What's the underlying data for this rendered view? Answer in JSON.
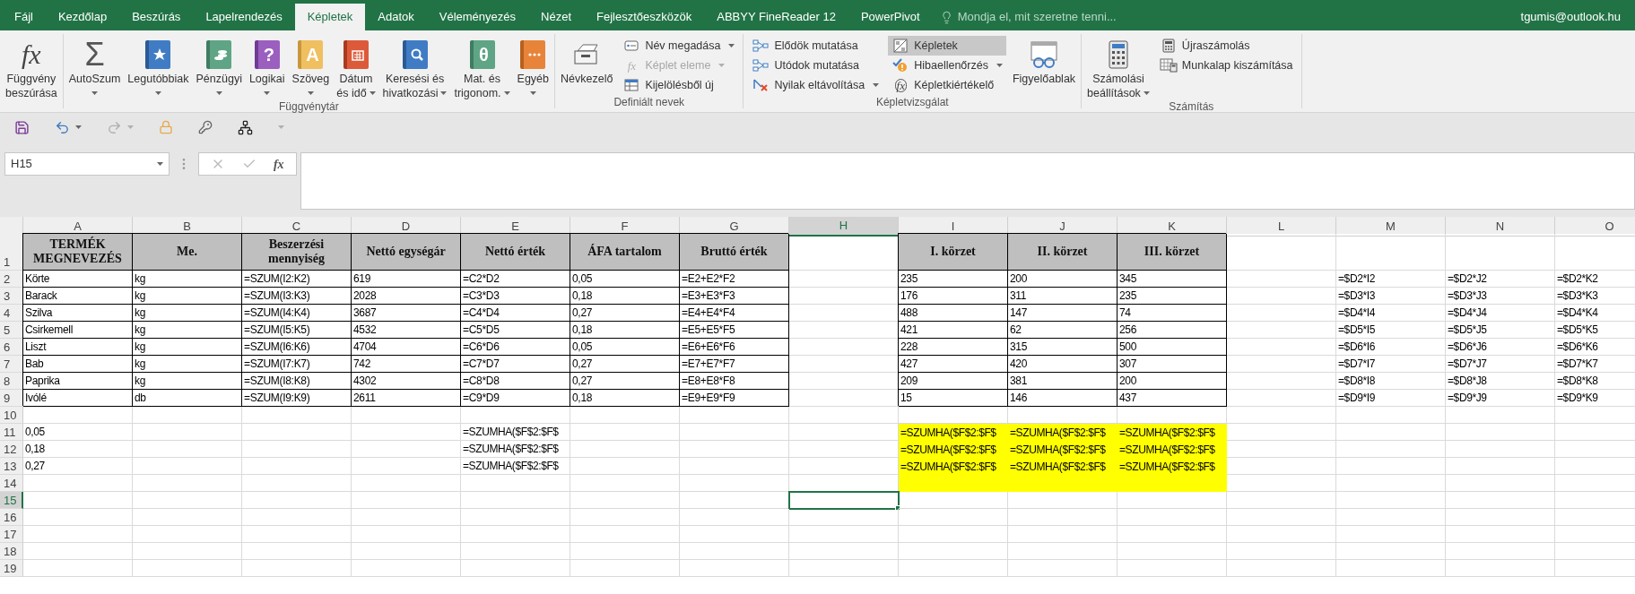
{
  "tabs": [
    {
      "label": "Fájl",
      "selected": false
    },
    {
      "label": "Kezdőlap",
      "selected": false
    },
    {
      "label": "Beszúrás",
      "selected": false
    },
    {
      "label": "Lapelrendezés",
      "selected": false
    },
    {
      "label": "Képletek",
      "selected": true
    },
    {
      "label": "Adatok",
      "selected": false
    },
    {
      "label": "Véleményezés",
      "selected": false
    },
    {
      "label": "Nézet",
      "selected": false
    },
    {
      "label": "Fejlesztőeszközök",
      "selected": false
    },
    {
      "label": "ABBYY FineReader 12",
      "selected": false
    },
    {
      "label": "PowerPivot",
      "selected": false
    }
  ],
  "tell_me": "Mondja el, mit szeretne tenni...",
  "account": "tgumis@outlook.hu",
  "ribbon": [
    {
      "items": [
        {
          "kind": "large",
          "lines": [
            "Függvény",
            "beszúrása"
          ],
          "dropdown": false,
          "icon_text": "fx"
        }
      ]
    },
    {
      "label": "Függvénytár",
      "items": [
        {
          "kind": "large",
          "lines": [
            "AutoSzum"
          ],
          "dropdown": true,
          "icon_text": "Σ"
        },
        {
          "kind": "large",
          "lines": [
            "Legutóbbiak"
          ],
          "dropdown": true
        },
        {
          "kind": "large",
          "lines": [
            "Pénzügyi"
          ],
          "dropdown": true
        },
        {
          "kind": "large",
          "lines": [
            "Logikai"
          ],
          "dropdown": true,
          "icon_text": "?"
        },
        {
          "kind": "large",
          "lines": [
            "Szöveg"
          ],
          "dropdown": true,
          "icon_text": "A"
        },
        {
          "kind": "large",
          "lines": [
            "Dátum",
            "és idő"
          ],
          "dropdown": true
        },
        {
          "kind": "large",
          "lines": [
            "Keresési és",
            "hivatkozási"
          ],
          "dropdown": true
        },
        {
          "kind": "large",
          "lines": [
            "Mat. és",
            "trigonom."
          ],
          "dropdown": true,
          "icon_text": "θ"
        },
        {
          "kind": "large",
          "lines": [
            "Egyéb"
          ],
          "dropdown": true
        }
      ]
    },
    {
      "label": "Definiált nevek",
      "items": [
        {
          "kind": "large",
          "lines": [
            "Névkezelő"
          ],
          "dropdown": false
        },
        {
          "kind": "stack",
          "items": [
            {
              "label": "Név megadása",
              "dropdown": true,
              "on": false,
              "disabled": false
            },
            {
              "label": "Képlet eleme",
              "dropdown": true,
              "on": false,
              "disabled": true,
              "icon_text": "fx"
            },
            {
              "label": "Kijelölésből új",
              "dropdown": false,
              "on": false,
              "disabled": false
            }
          ]
        }
      ]
    },
    {
      "label": "Képletvizsgálat",
      "items": [
        {
          "kind": "stack",
          "items": [
            {
              "label": "Elődök mutatása",
              "dropdown": false,
              "on": false,
              "disabled": false
            },
            {
              "label": "Utódok mutatása",
              "dropdown": false,
              "on": false,
              "disabled": false
            },
            {
              "label": "Nyilak eltávolítása",
              "dropdown": true,
              "on": false,
              "disabled": false
            }
          ]
        },
        {
          "kind": "stack",
          "items": [
            {
              "label": "Képletek",
              "dropdown": false,
              "on": true,
              "disabled": false
            },
            {
              "label": "Hibaellenőrzés",
              "dropdown": true,
              "on": false,
              "disabled": false
            },
            {
              "label": "Képletkiértékelő",
              "dropdown": false,
              "on": false,
              "disabled": false,
              "icon_text": "fx"
            }
          ]
        },
        {
          "kind": "large",
          "lines": [
            "Figyelőablak"
          ],
          "dropdown": false
        }
      ]
    },
    {
      "label": "Számítás",
      "items": [
        {
          "kind": "large",
          "lines": [
            "Számolási",
            "beállítások"
          ],
          "dropdown": true
        },
        {
          "kind": "stack",
          "items": [
            {
              "label": "Újraszámolás",
              "dropdown": false,
              "on": false,
              "disabled": false
            },
            {
              "label": "Munkalap kiszámítása",
              "dropdown": false,
              "on": false,
              "disabled": false
            }
          ]
        }
      ]
    }
  ],
  "formula_bar": {
    "name_box": "H15",
    "function_glyph": "fx"
  },
  "sheet": {
    "columns": [
      {
        "label": "A",
        "selected": false
      },
      {
        "label": "B",
        "selected": false
      },
      {
        "label": "C",
        "selected": false
      },
      {
        "label": "D",
        "selected": false
      },
      {
        "label": "E",
        "selected": false
      },
      {
        "label": "F",
        "selected": false
      },
      {
        "label": "G",
        "selected": false
      },
      {
        "label": "H",
        "selected": true
      },
      {
        "label": "I",
        "selected": false
      },
      {
        "label": "J",
        "selected": false
      },
      {
        "label": "K",
        "selected": false
      },
      {
        "label": "L",
        "selected": false
      },
      {
        "label": "M",
        "selected": false
      },
      {
        "label": "N",
        "selected": false
      },
      {
        "label": "O",
        "selected": false
      }
    ],
    "rows": [
      {
        "number": "1",
        "selected": false,
        "cells": [
          {
            "text": "TERMÉK MEGNEVEZÉS",
            "kind": "header"
          },
          {
            "text": "Me.",
            "kind": "header"
          },
          {
            "text": "Beszerzési mennyiség",
            "kind": "header"
          },
          {
            "text": "Nettó egységár",
            "kind": "header"
          },
          {
            "text": "Nettó érték",
            "kind": "header"
          },
          {
            "text": "ÁFA tartalom",
            "kind": "header"
          },
          {
            "text": "Bruttó érték",
            "kind": "header"
          },
          null,
          {
            "text": "I. körzet",
            "kind": "header"
          },
          {
            "text": "II. körzet",
            "kind": "header"
          },
          {
            "text": "III. körzet",
            "kind": "header"
          }
        ]
      },
      {
        "number": "2",
        "selected": false,
        "cells": [
          {
            "text": "Körte",
            "kind": "bordered"
          },
          {
            "text": "kg",
            "kind": "bordered"
          },
          {
            "text": "=SZUM(I2:K2)",
            "kind": "bordered"
          },
          {
            "text": "619",
            "kind": "bordered"
          },
          {
            "text": "=C2*D2",
            "kind": "bordered"
          },
          {
            "text": "0,05",
            "kind": "bordered"
          },
          {
            "text": "=E2+E2*F2",
            "kind": "bordered"
          },
          null,
          {
            "text": "235",
            "kind": "bordered"
          },
          {
            "text": "200",
            "kind": "bordered"
          },
          {
            "text": "345",
            "kind": "bordered"
          },
          null,
          {
            "text": "=$D2*I2",
            "kind": "plain"
          },
          {
            "text": "=$D2*J2",
            "kind": "plain"
          },
          {
            "text": "=$D2*K2",
            "kind": "plain"
          }
        ]
      },
      {
        "number": "3",
        "selected": false,
        "cells": [
          {
            "text": "Barack",
            "kind": "bordered"
          },
          {
            "text": "kg",
            "kind": "bordered"
          },
          {
            "text": "=SZUM(I3:K3)",
            "kind": "bordered"
          },
          {
            "text": "2028",
            "kind": "bordered"
          },
          {
            "text": "=C3*D3",
            "kind": "bordered"
          },
          {
            "text": "0,18",
            "kind": "bordered"
          },
          {
            "text": "=E3+E3*F3",
            "kind": "bordered"
          },
          null,
          {
            "text": "176",
            "kind": "bordered"
          },
          {
            "text": "311",
            "kind": "bordered"
          },
          {
            "text": "235",
            "kind": "bordered"
          },
          null,
          {
            "text": "=$D3*I3",
            "kind": "plain"
          },
          {
            "text": "=$D3*J3",
            "kind": "plain"
          },
          {
            "text": "=$D3*K3",
            "kind": "plain"
          }
        ]
      },
      {
        "number": "4",
        "selected": false,
        "cells": [
          {
            "text": "Szilva",
            "kind": "bordered"
          },
          {
            "text": "kg",
            "kind": "bordered"
          },
          {
            "text": "=SZUM(I4:K4)",
            "kind": "bordered"
          },
          {
            "text": "3687",
            "kind": "bordered"
          },
          {
            "text": "=C4*D4",
            "kind": "bordered"
          },
          {
            "text": "0,27",
            "kind": "bordered"
          },
          {
            "text": "=E4+E4*F4",
            "kind": "bordered"
          },
          null,
          {
            "text": "488",
            "kind": "bordered"
          },
          {
            "text": "147",
            "kind": "bordered"
          },
          {
            "text": "74",
            "kind": "bordered"
          },
          null,
          {
            "text": "=$D4*I4",
            "kind": "plain"
          },
          {
            "text": "=$D4*J4",
            "kind": "plain"
          },
          {
            "text": "=$D4*K4",
            "kind": "plain"
          }
        ]
      },
      {
        "number": "5",
        "selected": false,
        "cells": [
          {
            "text": "Csirkemell",
            "kind": "bordered"
          },
          {
            "text": "kg",
            "kind": "bordered"
          },
          {
            "text": "=SZUM(I5:K5)",
            "kind": "bordered"
          },
          {
            "text": "4532",
            "kind": "bordered"
          },
          {
            "text": "=C5*D5",
            "kind": "bordered"
          },
          {
            "text": "0,18",
            "kind": "bordered"
          },
          {
            "text": "=E5+E5*F5",
            "kind": "bordered"
          },
          null,
          {
            "text": "421",
            "kind": "bordered"
          },
          {
            "text": "62",
            "kind": "bordered"
          },
          {
            "text": "256",
            "kind": "bordered"
          },
          null,
          {
            "text": "=$D5*I5",
            "kind": "plain"
          },
          {
            "text": "=$D5*J5",
            "kind": "plain"
          },
          {
            "text": "=$D5*K5",
            "kind": "plain"
          }
        ]
      },
      {
        "number": "6",
        "selected": false,
        "cells": [
          {
            "text": "Liszt",
            "kind": "bordered"
          },
          {
            "text": "kg",
            "kind": "bordered"
          },
          {
            "text": "=SZUM(I6:K6)",
            "kind": "bordered"
          },
          {
            "text": "4704",
            "kind": "bordered"
          },
          {
            "text": "=C6*D6",
            "kind": "bordered"
          },
          {
            "text": "0,05",
            "kind": "bordered"
          },
          {
            "text": "=E6+E6*F6",
            "kind": "bordered"
          },
          null,
          {
            "text": "228",
            "kind": "bordered"
          },
          {
            "text": "315",
            "kind": "bordered"
          },
          {
            "text": "500",
            "kind": "bordered"
          },
          null,
          {
            "text": "=$D6*I6",
            "kind": "plain"
          },
          {
            "text": "=$D6*J6",
            "kind": "plain"
          },
          {
            "text": "=$D6*K6",
            "kind": "plain"
          }
        ]
      },
      {
        "number": "7",
        "selected": false,
        "cells": [
          {
            "text": "Bab",
            "kind": "bordered"
          },
          {
            "text": "kg",
            "kind": "bordered"
          },
          {
            "text": "=SZUM(I7:K7)",
            "kind": "bordered"
          },
          {
            "text": "742",
            "kind": "bordered"
          },
          {
            "text": "=C7*D7",
            "kind": "bordered"
          },
          {
            "text": "0,27",
            "kind": "bordered"
          },
          {
            "text": "=E7+E7*F7",
            "kind": "bordered"
          },
          null,
          {
            "text": "427",
            "kind": "bordered"
          },
          {
            "text": "420",
            "kind": "bordered"
          },
          {
            "text": "307",
            "kind": "bordered"
          },
          null,
          {
            "text": "=$D7*I7",
            "kind": "plain"
          },
          {
            "text": "=$D7*J7",
            "kind": "plain"
          },
          {
            "text": "=$D7*K7",
            "kind": "plain"
          }
        ]
      },
      {
        "number": "8",
        "selected": false,
        "cells": [
          {
            "text": "Paprika",
            "kind": "bordered"
          },
          {
            "text": "kg",
            "kind": "bordered"
          },
          {
            "text": "=SZUM(I8:K8)",
            "kind": "bordered"
          },
          {
            "text": "4302",
            "kind": "bordered"
          },
          {
            "text": "=C8*D8",
            "kind": "bordered"
          },
          {
            "text": "0,27",
            "kind": "bordered"
          },
          {
            "text": "=E8+E8*F8",
            "kind": "bordered"
          },
          null,
          {
            "text": "209",
            "kind": "bordered"
          },
          {
            "text": "381",
            "kind": "bordered"
          },
          {
            "text": "200",
            "kind": "bordered"
          },
          null,
          {
            "text": "=$D8*I8",
            "kind": "plain"
          },
          {
            "text": "=$D8*J8",
            "kind": "plain"
          },
          {
            "text": "=$D8*K8",
            "kind": "plain"
          }
        ]
      },
      {
        "number": "9",
        "selected": false,
        "cells": [
          {
            "text": "Ivólé",
            "kind": "bordered"
          },
          {
            "text": "db",
            "kind": "bordered"
          },
          {
            "text": "=SZUM(I9:K9)",
            "kind": "bordered"
          },
          {
            "text": "2611",
            "kind": "bordered"
          },
          {
            "text": "=C9*D9",
            "kind": "bordered"
          },
          {
            "text": "0,18",
            "kind": "bordered"
          },
          {
            "text": "=E9+E9*F9",
            "kind": "bordered"
          },
          null,
          {
            "text": "15",
            "kind": "bordered"
          },
          {
            "text": "146",
            "kind": "bordered"
          },
          {
            "text": "437",
            "kind": "bordered"
          },
          null,
          {
            "text": "=$D9*I9",
            "kind": "plain"
          },
          {
            "text": "=$D9*J9",
            "kind": "plain"
          },
          {
            "text": "=$D9*K9",
            "kind": "plain"
          }
        ]
      },
      {
        "number": "10",
        "selected": false
      },
      {
        "number": "11",
        "selected": false,
        "cells": [
          {
            "text": "0,05",
            "kind": "plain"
          },
          null,
          null,
          null,
          {
            "text": "=SZUMHA($F$2:$F$",
            "kind": "plain"
          },
          null,
          null,
          null,
          {
            "text": "=SZUMHA($F$2:$F$",
            "kind": "highlight"
          },
          {
            "text": "=SZUMHA($F$2:$F$",
            "kind": "highlight"
          },
          {
            "text": "=SZUMHA($F$2:$F$",
            "kind": "highlight"
          }
        ]
      },
      {
        "number": "12",
        "selected": false,
        "cells": [
          {
            "text": "0,18",
            "kind": "plain"
          },
          null,
          null,
          null,
          {
            "text": "=SZUMHA($F$2:$F$",
            "kind": "plain"
          },
          null,
          null,
          null,
          {
            "text": "=SZUMHA($F$2:$F$",
            "kind": "highlight"
          },
          {
            "text": "=SZUMHA($F$2:$F$",
            "kind": "highlight"
          },
          {
            "text": "=SZUMHA($F$2:$F$",
            "kind": "highlight"
          }
        ]
      },
      {
        "number": "13",
        "selected": false,
        "cells": [
          {
            "text": "0,27",
            "kind": "plain"
          },
          null,
          null,
          null,
          {
            "text": "=SZUMHA($F$2:$F$",
            "kind": "plain"
          },
          null,
          null,
          null,
          {
            "text": "=SZUMHA($F$2:$F$",
            "kind": "highlight"
          },
          {
            "text": "=SZUMHA($F$2:$F$",
            "kind": "highlight"
          },
          {
            "text": "=SZUMHA($F$2:$F$",
            "kind": "highlight"
          }
        ]
      },
      {
        "number": "14",
        "selected": false,
        "cells": [
          null,
          null,
          null,
          null,
          null,
          null,
          null,
          null,
          {
            "kind": "highlight"
          },
          {
            "kind": "highlight"
          },
          {
            "kind": "highlight"
          }
        ]
      },
      {
        "number": "15",
        "selected": true
      },
      {
        "number": "16",
        "selected": false
      },
      {
        "number": "17",
        "selected": false
      },
      {
        "number": "18",
        "selected": false
      },
      {
        "number": "19",
        "selected": false
      }
    ]
  }
}
